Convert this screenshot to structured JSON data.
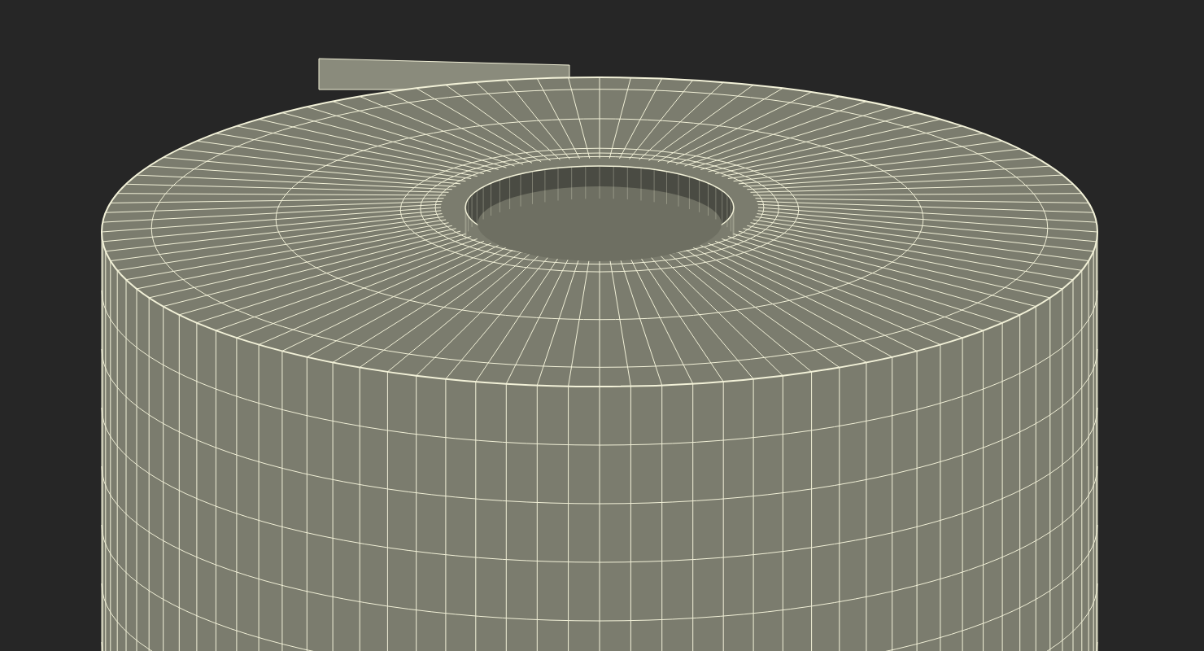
{
  "scene": {
    "kind": "wireframe-roll"
  }
}
